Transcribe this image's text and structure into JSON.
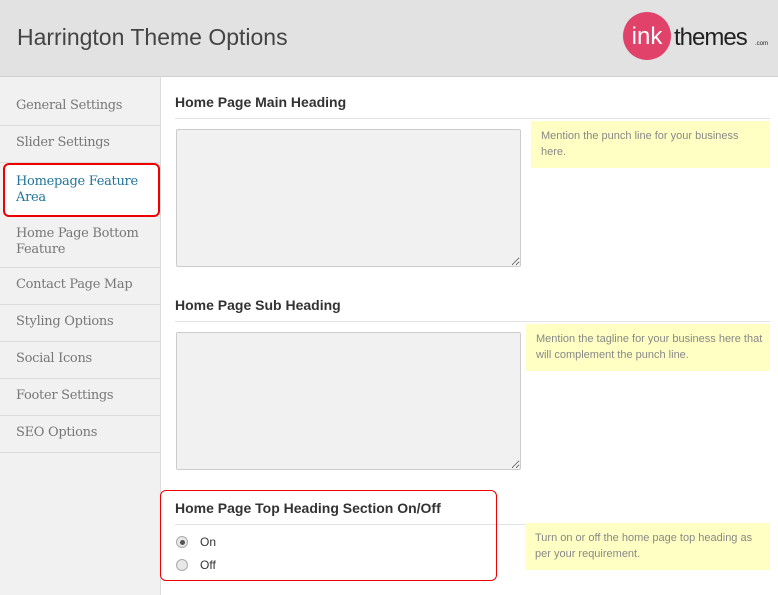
{
  "header": {
    "title": "Harrington Theme Options",
    "logo_text": "inkthemes.com"
  },
  "sidebar": {
    "items": [
      {
        "label": "General Settings"
      },
      {
        "label": "Slider Settings"
      },
      {
        "label": "Homepage Feature Area",
        "active": true
      },
      {
        "label": "Home Page Bottom Feature"
      },
      {
        "label": "Contact Page Map"
      },
      {
        "label": "Styling Options"
      },
      {
        "label": "Social Icons"
      },
      {
        "label": "Footer Settings"
      },
      {
        "label": "SEO Options"
      }
    ]
  },
  "main": {
    "main_heading": {
      "label": "Home Page Main Heading",
      "value": "",
      "hint": "Mention the punch line for your business here."
    },
    "sub_heading": {
      "label": "Home Page Sub Heading",
      "value": "",
      "hint": "Mention the tagline for your business here that will complement the punch line."
    },
    "top_heading_toggle": {
      "label": "Home Page Top Heading Section On/Off",
      "options": [
        "On",
        "Off"
      ],
      "selected": "On",
      "hint": "Turn on or off the home page top heading as per your requirement."
    }
  },
  "colors": {
    "accent": "#21759b",
    "highlight": "#ee0000",
    "hint_bg": "#ffffc4",
    "logo": "#e0426a"
  }
}
